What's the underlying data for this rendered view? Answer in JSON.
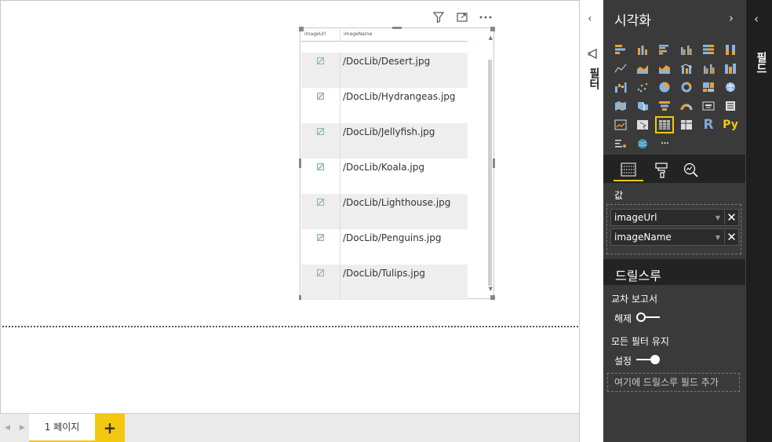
{
  "visual_header": {
    "filter_icon": "filter-icon",
    "focus_icon": "focus-mode-icon",
    "more_icon": "more-options-icon"
  },
  "table": {
    "headers": [
      "imageUrl",
      "imageName"
    ],
    "rows": [
      {
        "image": "broken-image-icon",
        "name": "/DocLib/Desert.jpg"
      },
      {
        "image": "broken-image-icon",
        "name": "/DocLib/Hydrangeas.jpg"
      },
      {
        "image": "broken-image-icon",
        "name": "/DocLib/Jellyfish.jpg"
      },
      {
        "image": "broken-image-icon",
        "name": "/DocLib/Koala.jpg"
      },
      {
        "image": "broken-image-icon",
        "name": "/DocLib/Lighthouse.jpg"
      },
      {
        "image": "broken-image-icon",
        "name": "/DocLib/Penguins.jpg"
      },
      {
        "image": "broken-image-icon",
        "name": "/DocLib/Tulips.jpg"
      }
    ]
  },
  "page_tabs": {
    "active": "1 페이지",
    "add": "+"
  },
  "filter_pane": {
    "label": "필터",
    "collapse": "‹"
  },
  "viz_pane": {
    "title": "시각화",
    "collapse": "›",
    "tabs": {
      "fields": "fields-icon",
      "format": "format-paint-icon",
      "analytics": "analytics-icon"
    },
    "values_label": "값",
    "fields": [
      "imageUrl",
      "imageName"
    ],
    "drill_title": "드릴스루",
    "cross_report_label": "교차 보고서",
    "cross_report_state": "해제",
    "keep_filters_label": "모든 필터 유지",
    "keep_filters_state": "설정",
    "drill_placeholder": "여기에 드릴스루 필드 추가",
    "more": "···",
    "r_label": "R",
    "py_label": "Py"
  },
  "fields_pane": {
    "label": "필드",
    "expand": "‹"
  },
  "colors": {
    "accent": "#f2c811",
    "pane_bg": "#3a3a3a",
    "pane_dark": "#232323"
  }
}
